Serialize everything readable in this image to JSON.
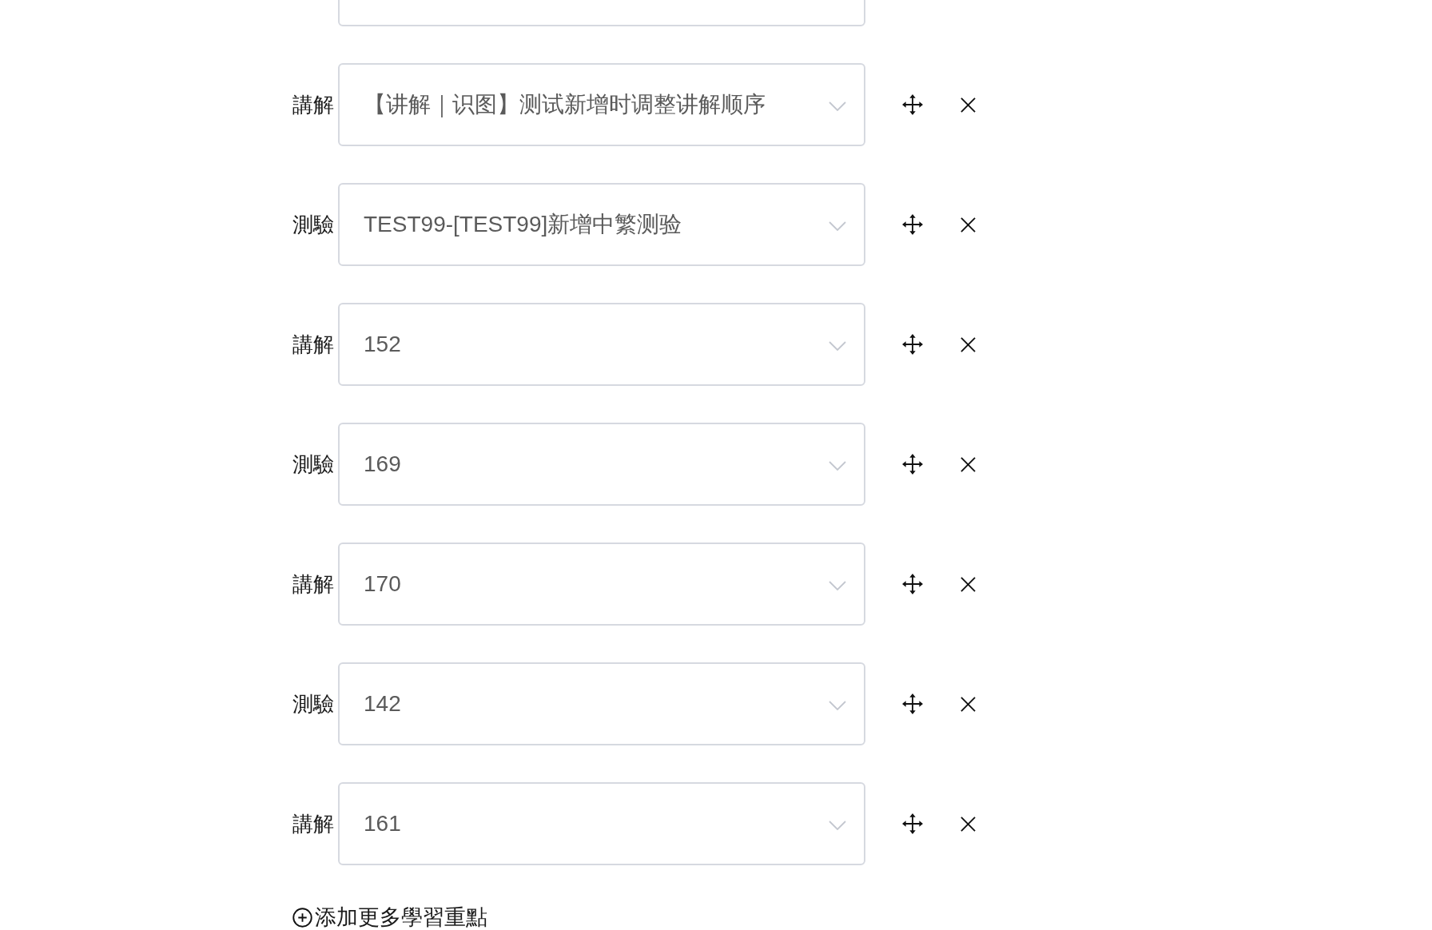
{
  "items": [
    {
      "kind": "cut"
    },
    {
      "kind": "row",
      "label": "講解",
      "value": "【讲解｜识图】测试新增时调整讲解顺序"
    },
    {
      "kind": "row",
      "label": "測驗",
      "value": "TEST99-[TEST99]新增中繁测验"
    },
    {
      "kind": "row",
      "label": "講解",
      "value": "152"
    },
    {
      "kind": "row",
      "label": "測驗",
      "value": "169"
    },
    {
      "kind": "row",
      "label": "講解",
      "value": "170"
    },
    {
      "kind": "row",
      "label": "測驗",
      "value": "142"
    },
    {
      "kind": "row",
      "label": "講解",
      "value": "161"
    }
  ],
  "add_button": {
    "label": "添加更多學習重點"
  }
}
